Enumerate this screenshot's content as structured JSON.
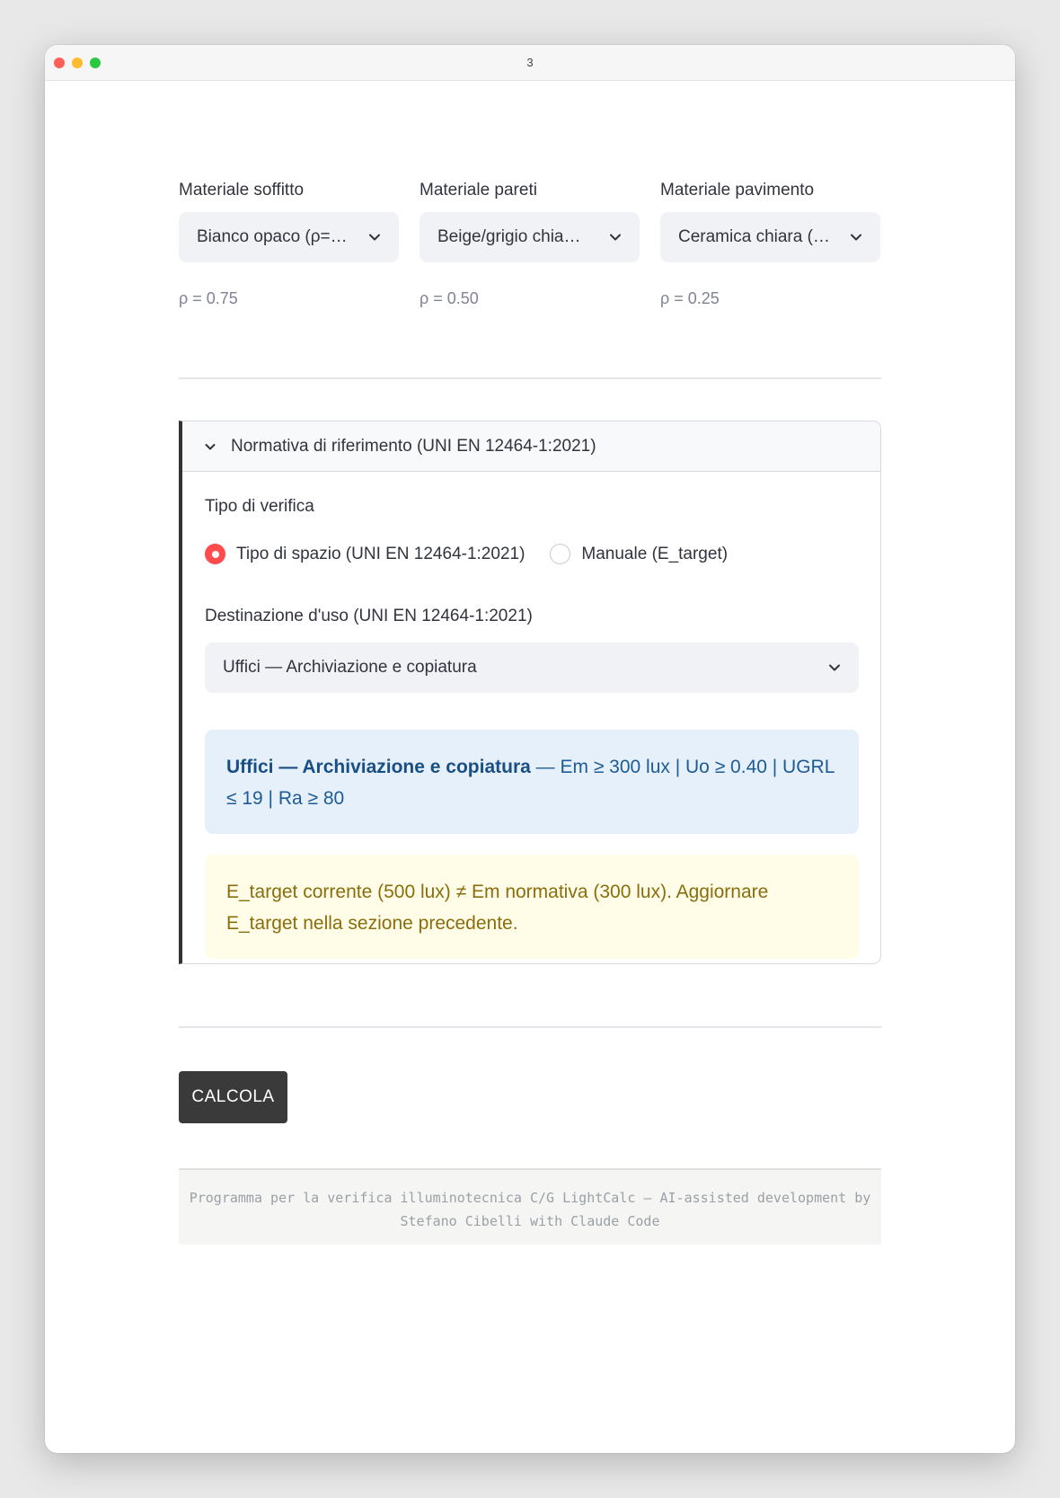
{
  "window": {
    "title": "3"
  },
  "materials": [
    {
      "label": "Materiale soffitto",
      "value": "Bianco opaco (ρ=…",
      "rho": "ρ = 0.75"
    },
    {
      "label": "Materiale pareti",
      "value": "Beige/grigio chia…",
      "rho": "ρ = 0.50"
    },
    {
      "label": "Materiale pavimento",
      "value": "Ceramica chiara (…",
      "rho": "ρ = 0.25"
    }
  ],
  "expander": {
    "title": "Normativa di riferimento (UNI EN 12464-1:2021)",
    "verification_label": "Tipo di verifica",
    "radio_options": [
      {
        "label": "Tipo di spazio (UNI EN 12464-1:2021)",
        "selected": true
      },
      {
        "label": "Manuale (E_target)",
        "selected": false
      }
    ],
    "destination_label": "Destinazione d'uso (UNI EN 12464-1:2021)",
    "destination_value": "Uffici — Archiviazione e copiatura",
    "info": {
      "bold": "Uffici — Archiviazione e copiatura",
      "text": " — Em ≥ 300 lux | Uo ≥ 0.40 | UGRL ≤ 19 | Ra ≥ 80"
    },
    "warning": "E_target corrente (500 lux) ≠ Em normativa (300 lux). Aggiornare E_target nella sezione precedente."
  },
  "button": {
    "label": "CALCOLA"
  },
  "footer": {
    "line1": "Programma per la verifica illuminotecnica C/G LightCalc  —  AI-assisted development by",
    "line2": "Stefano Cibelli with Claude Code"
  },
  "colors": {
    "accent": "#ff4b4b",
    "info_bg": "#e6f0fb",
    "info_text": "#1d5b96",
    "warning_bg": "#fffde8",
    "warning_text": "#8a6d0c",
    "button_bg": "#3a3a3a"
  }
}
